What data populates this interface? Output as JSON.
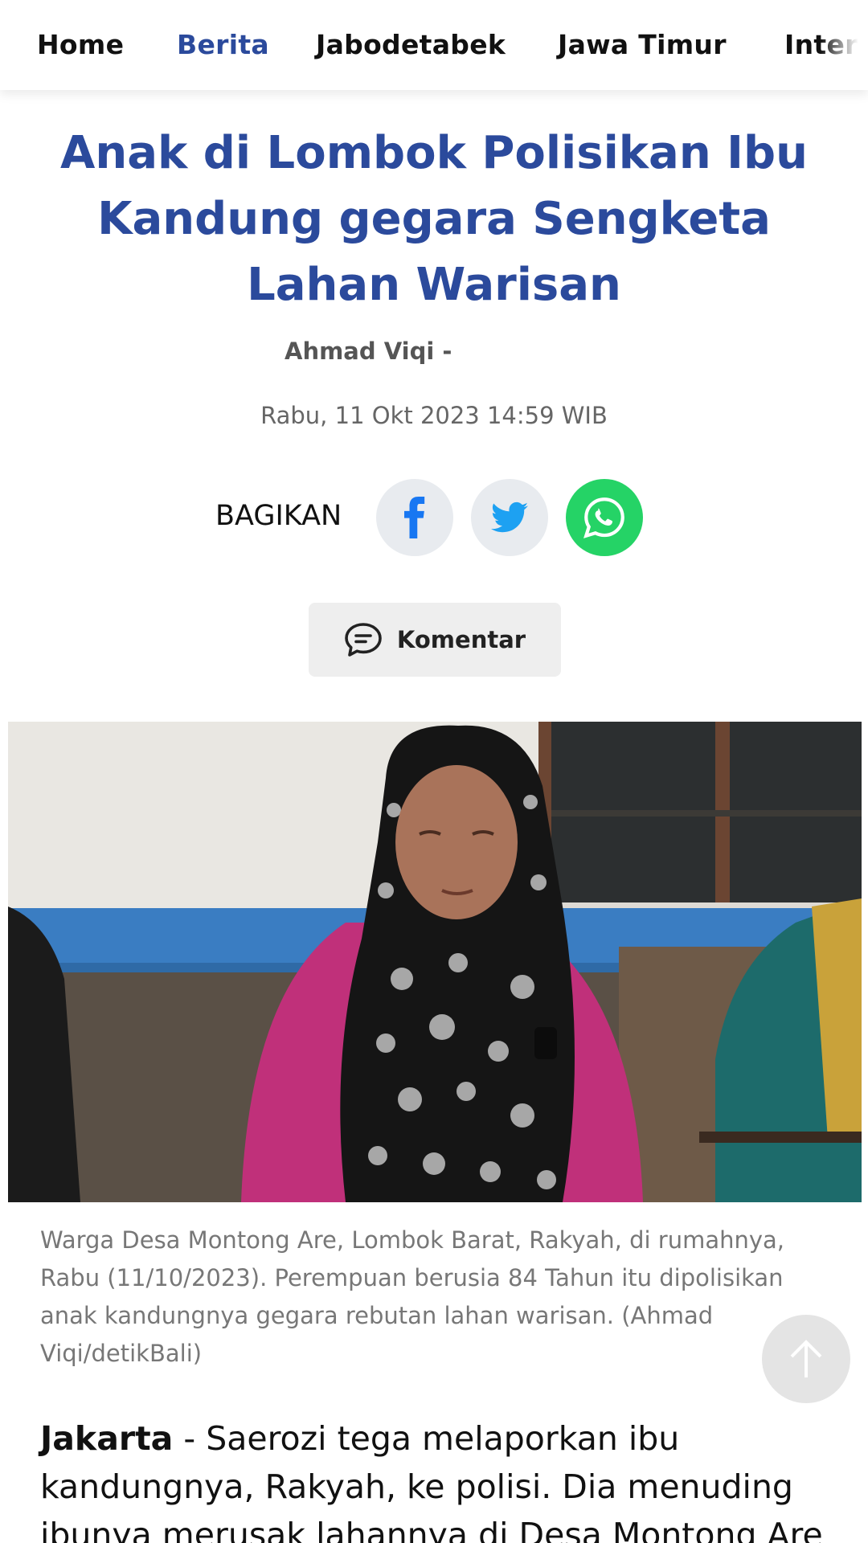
{
  "nav": {
    "items": [
      {
        "label": "Home",
        "active": false
      },
      {
        "label": "Berita",
        "active": true
      },
      {
        "label": "Jabodetabek",
        "active": false
      },
      {
        "label": "Jawa Timur",
        "active": false
      },
      {
        "label": "Inter",
        "active": false
      }
    ]
  },
  "article": {
    "title": "Anak di Lombok Polisikan Ibu Kandung gegara Sengketa Lahan Warisan",
    "author": "Ahmad Viqi -",
    "date": "Rabu, 11 Okt 2023 14:59 WIB"
  },
  "share": {
    "label": "BAGIKAN",
    "icons": [
      "facebook-icon",
      "twitter-icon",
      "whatsapp-icon"
    ]
  },
  "comment": {
    "label": "Komentar"
  },
  "photo": {
    "caption": "Warga Desa Montong Are, Lombok Barat, Rakyah, di rumahnya, Rabu (11/10/2023). Perempuan berusia 84 Tahun itu dipolisikan anak kandungnya gegara rebutan lahan warisan. (Ahmad Viqi/detikBali)"
  },
  "body": {
    "dateline": "Jakarta",
    "text": " - Saerozi tega melaporkan ibu kandungnya, Rakyah, ke polisi. Dia menuding ibunya merusak lahannya di Desa Montong Are"
  },
  "colors": {
    "accent": "#2b4a9c",
    "whatsapp": "#25d366",
    "twitter": "#1da1f2",
    "facebook": "#1877f2"
  }
}
